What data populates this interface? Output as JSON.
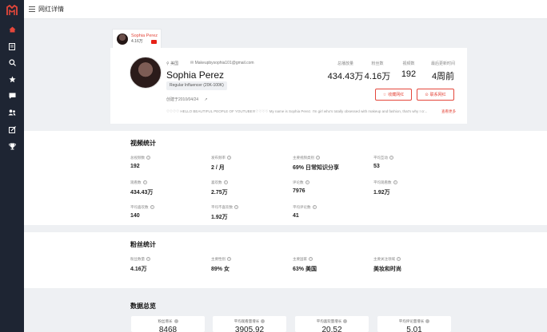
{
  "topbar": {
    "title": "网红详情"
  },
  "tab": {
    "name": "Sophia Perez",
    "followers": "4.16万"
  },
  "profile": {
    "location": "美国",
    "email": "Makeupbysophia101@gmail.com",
    "name": "Sophia Perez",
    "tag": "Regular Influencer (20K-100K)",
    "created": "创建于2010/04/24",
    "bio": "♡♡♡♡ HELLO BEAUTIFUL PEOPLE OF YOUTUBE!!!♡♡♡♡ My name is Sophia Perez. I'm girl who's totally obsessed with makeup and fashion, that's why I cr...",
    "more": "查看更多",
    "stats": [
      {
        "label": "总播放量",
        "value": "434.43万"
      },
      {
        "label": "粉丝数",
        "value": "4.16万"
      },
      {
        "label": "视频数",
        "value": "192"
      },
      {
        "label": "最后更新时间",
        "value": "4周前"
      }
    ],
    "buttons": {
      "favorite": "收藏网红",
      "contact": "联系网红"
    }
  },
  "video_stats": {
    "title": "视频统计",
    "items": [
      {
        "label": "总视频数",
        "value": "192"
      },
      {
        "label": "发布频率",
        "value": "2 / 月"
      },
      {
        "label": "主要视频类别",
        "value": "69% 日常知识分享"
      },
      {
        "label": "平均互动",
        "value": "53"
      },
      {
        "label": "观看数",
        "value": "434.43万"
      },
      {
        "label": "喜欢数",
        "value": "2.75万"
      },
      {
        "label": "评论数",
        "value": "7976"
      },
      {
        "label": "平均观看数",
        "value": "1.92万"
      },
      {
        "label": "平均喜欢数",
        "value": "140"
      },
      {
        "label": "平均不喜欢数",
        "value": "1.92万"
      },
      {
        "label": "平均评论数",
        "value": "41"
      }
    ]
  },
  "fan_stats": {
    "title": "粉丝统计",
    "items": [
      {
        "label": "粉丝数量",
        "value": "4.16万"
      },
      {
        "label": "主要性别",
        "value": "89% 女"
      },
      {
        "label": "主要国家",
        "value": "63% 美国"
      },
      {
        "label": "主要关注领域",
        "value": "美妆和时尚"
      }
    ]
  },
  "overview": {
    "title": "数据总览",
    "cards": [
      {
        "label": "粉丝增长",
        "value": "8468"
      },
      {
        "label": "平均观看量增长",
        "value": "3905.92"
      },
      {
        "label": "平均喜欢量增长",
        "value": "20.52"
      },
      {
        "label": "平均评论量增长",
        "value": "5.01"
      }
    ]
  },
  "colors": {
    "accent": "#e4473b",
    "sidebar": "#1e2533"
  }
}
